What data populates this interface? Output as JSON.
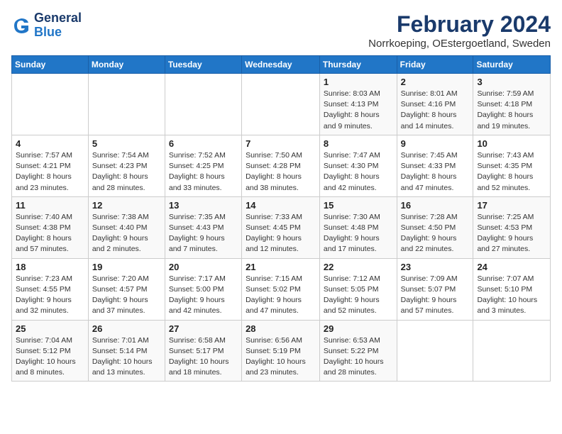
{
  "logo": {
    "line1": "General",
    "line2": "Blue"
  },
  "title": "February 2024",
  "subtitle": "Norrkoeping, OEstergoetland, Sweden",
  "days_of_week": [
    "Sunday",
    "Monday",
    "Tuesday",
    "Wednesday",
    "Thursday",
    "Friday",
    "Saturday"
  ],
  "weeks": [
    [
      {
        "num": "",
        "info": ""
      },
      {
        "num": "",
        "info": ""
      },
      {
        "num": "",
        "info": ""
      },
      {
        "num": "",
        "info": ""
      },
      {
        "num": "1",
        "info": "Sunrise: 8:03 AM\nSunset: 4:13 PM\nDaylight: 8 hours\nand 9 minutes."
      },
      {
        "num": "2",
        "info": "Sunrise: 8:01 AM\nSunset: 4:16 PM\nDaylight: 8 hours\nand 14 minutes."
      },
      {
        "num": "3",
        "info": "Sunrise: 7:59 AM\nSunset: 4:18 PM\nDaylight: 8 hours\nand 19 minutes."
      }
    ],
    [
      {
        "num": "4",
        "info": "Sunrise: 7:57 AM\nSunset: 4:21 PM\nDaylight: 8 hours\nand 23 minutes."
      },
      {
        "num": "5",
        "info": "Sunrise: 7:54 AM\nSunset: 4:23 PM\nDaylight: 8 hours\nand 28 minutes."
      },
      {
        "num": "6",
        "info": "Sunrise: 7:52 AM\nSunset: 4:25 PM\nDaylight: 8 hours\nand 33 minutes."
      },
      {
        "num": "7",
        "info": "Sunrise: 7:50 AM\nSunset: 4:28 PM\nDaylight: 8 hours\nand 38 minutes."
      },
      {
        "num": "8",
        "info": "Sunrise: 7:47 AM\nSunset: 4:30 PM\nDaylight: 8 hours\nand 42 minutes."
      },
      {
        "num": "9",
        "info": "Sunrise: 7:45 AM\nSunset: 4:33 PM\nDaylight: 8 hours\nand 47 minutes."
      },
      {
        "num": "10",
        "info": "Sunrise: 7:43 AM\nSunset: 4:35 PM\nDaylight: 8 hours\nand 52 minutes."
      }
    ],
    [
      {
        "num": "11",
        "info": "Sunrise: 7:40 AM\nSunset: 4:38 PM\nDaylight: 8 hours\nand 57 minutes."
      },
      {
        "num": "12",
        "info": "Sunrise: 7:38 AM\nSunset: 4:40 PM\nDaylight: 9 hours\nand 2 minutes."
      },
      {
        "num": "13",
        "info": "Sunrise: 7:35 AM\nSunset: 4:43 PM\nDaylight: 9 hours\nand 7 minutes."
      },
      {
        "num": "14",
        "info": "Sunrise: 7:33 AM\nSunset: 4:45 PM\nDaylight: 9 hours\nand 12 minutes."
      },
      {
        "num": "15",
        "info": "Sunrise: 7:30 AM\nSunset: 4:48 PM\nDaylight: 9 hours\nand 17 minutes."
      },
      {
        "num": "16",
        "info": "Sunrise: 7:28 AM\nSunset: 4:50 PM\nDaylight: 9 hours\nand 22 minutes."
      },
      {
        "num": "17",
        "info": "Sunrise: 7:25 AM\nSunset: 4:53 PM\nDaylight: 9 hours\nand 27 minutes."
      }
    ],
    [
      {
        "num": "18",
        "info": "Sunrise: 7:23 AM\nSunset: 4:55 PM\nDaylight: 9 hours\nand 32 minutes."
      },
      {
        "num": "19",
        "info": "Sunrise: 7:20 AM\nSunset: 4:57 PM\nDaylight: 9 hours\nand 37 minutes."
      },
      {
        "num": "20",
        "info": "Sunrise: 7:17 AM\nSunset: 5:00 PM\nDaylight: 9 hours\nand 42 minutes."
      },
      {
        "num": "21",
        "info": "Sunrise: 7:15 AM\nSunset: 5:02 PM\nDaylight: 9 hours\nand 47 minutes."
      },
      {
        "num": "22",
        "info": "Sunrise: 7:12 AM\nSunset: 5:05 PM\nDaylight: 9 hours\nand 52 minutes."
      },
      {
        "num": "23",
        "info": "Sunrise: 7:09 AM\nSunset: 5:07 PM\nDaylight: 9 hours\nand 57 minutes."
      },
      {
        "num": "24",
        "info": "Sunrise: 7:07 AM\nSunset: 5:10 PM\nDaylight: 10 hours\nand 3 minutes."
      }
    ],
    [
      {
        "num": "25",
        "info": "Sunrise: 7:04 AM\nSunset: 5:12 PM\nDaylight: 10 hours\nand 8 minutes."
      },
      {
        "num": "26",
        "info": "Sunrise: 7:01 AM\nSunset: 5:14 PM\nDaylight: 10 hours\nand 13 minutes."
      },
      {
        "num": "27",
        "info": "Sunrise: 6:58 AM\nSunset: 5:17 PM\nDaylight: 10 hours\nand 18 minutes."
      },
      {
        "num": "28",
        "info": "Sunrise: 6:56 AM\nSunset: 5:19 PM\nDaylight: 10 hours\nand 23 minutes."
      },
      {
        "num": "29",
        "info": "Sunrise: 6:53 AM\nSunset: 5:22 PM\nDaylight: 10 hours\nand 28 minutes."
      },
      {
        "num": "",
        "info": ""
      },
      {
        "num": "",
        "info": ""
      }
    ]
  ]
}
